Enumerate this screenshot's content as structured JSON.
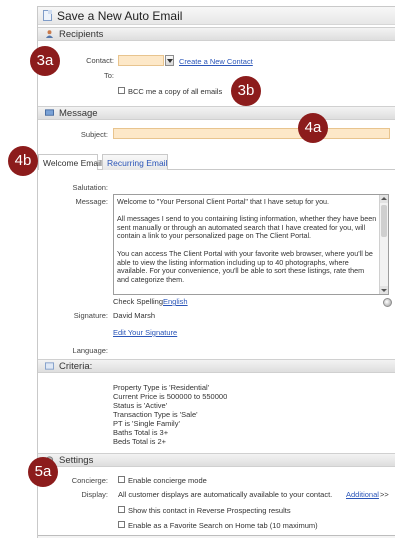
{
  "window": {
    "title": "Save a New Auto Email"
  },
  "recipients": {
    "header": "Recipients",
    "contact_label": "Contact:",
    "contact_value": "",
    "create_contact_link": "Create a New Contact",
    "to_label": "To:",
    "bcc_label": "BCC me a copy of all emails"
  },
  "message": {
    "header": "Message",
    "subject_label": "Subject:",
    "subject_value": ""
  },
  "tabs": [
    {
      "label": "Welcome Email",
      "active": true
    },
    {
      "label": "Recurring Email",
      "active": false
    }
  ],
  "email_form": {
    "salutation_label": "Salutation:",
    "message_label": "Message:",
    "message_paragraphs": [
      "Welcome to \"Your Personal Client Portal\" that I have setup for you.",
      "All messages I send to you containing listing information, whether they have been sent manually or through an automated search that I have created for you, will contain a link to your personalized page on The Client Portal.",
      "You can access The Client Portal with your favorite web browser, where you'll be able to view the listing information including up to 40 photographs, where available. For your convenience, you'll be able to sort these listings, rate them and categorize them."
    ],
    "check_spelling_label": "Check Spelling",
    "check_spelling_language": "English",
    "signature_label": "Signature:",
    "signature_value": "David Marsh",
    "edit_signature_link": "Edit Your Signature",
    "language_label": "Language:"
  },
  "criteria": {
    "header": "Criteria:",
    "lines": [
      "Property Type is 'Residential'",
      "Current Price is 500000 to 550000",
      "Status is 'Active'",
      "Transaction Type is 'Sale'",
      "PT is 'Single Family'",
      "Baths Total is 3+",
      "Beds Total is 2+"
    ]
  },
  "settings": {
    "header": "Settings",
    "concierge_label": "Concierge:",
    "concierge_option": "Enable concierge mode",
    "display_label": "Display:",
    "display_text": "All customer displays are automatically available to your contact.",
    "additional_link": "Additional",
    "additional_suffix": ">>",
    "reverse_prospecting_option": "Show this contact in Reverse Prospecting results",
    "favorite_search_option": "Enable as a Favorite Search on Home tab (10 maximum)"
  },
  "callouts": [
    "3a",
    "3b",
    "4a",
    "4b",
    "5a"
  ],
  "colors": {
    "callout": "#8c1c1c",
    "required_field": "#fde8c8",
    "link": "#2a55b8"
  }
}
